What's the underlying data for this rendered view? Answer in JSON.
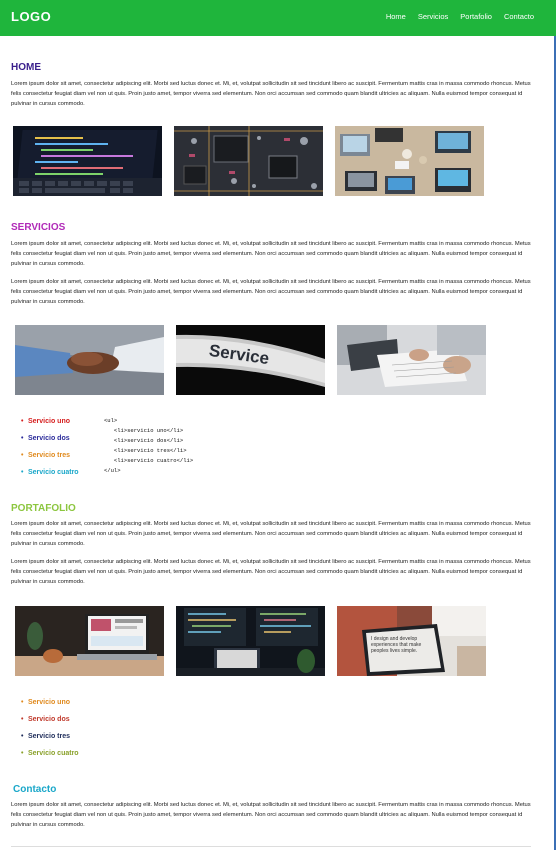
{
  "header": {
    "logo": "LOGO",
    "nav": [
      "Home",
      "Servicios",
      "Portafolio",
      "Contacto"
    ]
  },
  "home": {
    "title": "HOME",
    "text": "Lorem ipsum dolor sit amet, consectetur adipiscing elit. Morbi sed luctus donec et. Mi, et, volutpat sollicitudin sit sed tincidunt libero ac suscipit. Fermentum mattis cras in massa commodo rhoncus. Metus felis consectetur feugiat diam vel non ut quis. Proin justo amet, tempor viverra sed elementum. Non orci accumsan sed commodo quam blandit ultricies ac aliquam. Nulla euismod tempor consequat id pulvinar in cursus commodo."
  },
  "servicios": {
    "title": "SERVICIOS",
    "text1": "Lorem ipsum dolor sit amet, consectetur adipiscing elit. Morbi sed luctus donec et. Mi, et, volutpat sollicitudin sit sed tincidunt libero ac suscipit. Fermentum mattis cras in massa commodo rhoncus. Metus felis consectetur feugiat diam vel non ut quis. Proin justo amet, tempor viverra sed elementum. Non orci accumsan sed commodo quam blandit ultricies ac aliquam. Nulla euismod tempor consequat id pulvinar in cursus commodo.",
    "text2": "Lorem ipsum dolor sit amet, consectetur adipiscing elit. Morbi sed luctus donec et. Mi, et, volutpat sollicitudin sit sed tincidunt libero ac suscipit. Fermentum mattis cras in massa commodo rhoncus. Metus felis consectetur feugiat diam vel non ut quis. Proin justo amet, tempor viverra sed elementum. Non orci accumsan sed commodo quam blandit ultricies ac aliquam. Nulla euismod tempor consequat id pulvinar in cursus commodo.",
    "service_image_label": "Service",
    "items": [
      {
        "label": "Servicio uno",
        "color": "#d62020"
      },
      {
        "label": "Servicio dos",
        "color": "#2a2a9a"
      },
      {
        "label": "Servicio tres",
        "color": "#e08a1e"
      },
      {
        "label": "Servicio cuatro",
        "color": "#1aa7c9"
      }
    ],
    "code": "<ul>\n   <li>servicio uno</li>\n   <li>servicio dos</li>\n   <li>servicio tres</li>\n   <li>servicio cuatro</li>\n</ul>"
  },
  "portafolio": {
    "title": "PORTAFOLIO",
    "text1": "Lorem ipsum dolor sit amet, consectetur adipiscing elit. Morbi sed luctus donec et. Mi, et, volutpat sollicitudin sit sed tincidunt libero ac suscipit. Fermentum mattis cras in massa commodo rhoncus. Metus felis consectetur feugiat diam vel non ut quis. Proin justo amet, tempor viverra sed elementum. Non orci accumsan sed commodo quam blandit ultricies ac aliquam. Nulla euismod tempor consequat id pulvinar in cursus commodo.",
    "text2": "Lorem ipsum dolor sit amet, consectetur adipiscing elit. Morbi sed luctus donec et. Mi, et, volutpat sollicitudin sit sed tincidunt libero ac suscipit. Fermentum mattis cras in massa commodo rhoncus. Metus felis consectetur feugiat diam vel non ut quis. Proin justo amet, tempor viverra sed elementum. Non orci accumsan sed commodo quam blandit ultricies ac aliquam. Nulla euismod tempor consequat id pulvinar in cursus commodo.",
    "screen_text": "I design and develop experiences that make peoples lives simple.",
    "items": [
      {
        "label": "Servicio uno",
        "color": "#e08a1e"
      },
      {
        "label": "Servicio dos",
        "color": "#c0392b"
      },
      {
        "label": "Servicio tres",
        "color": "#1f2d5a"
      },
      {
        "label": "Servicio cuatro",
        "color": "#8aa12a"
      }
    ]
  },
  "contacto": {
    "title": "Contacto",
    "text": "Lorem ipsum dolor sit amet, consectetur adipiscing elit. Morbi sed luctus donec et. Mi, et, volutpat sollicitudin sit sed tincidunt libero ac suscipit. Fermentum mattis cras in massa commodo rhoncus. Metus felis consectetur feugiat diam vel non ut quis. Proin justo amet, tempor viverra sed elementum. Non orci accumsan sed commodo quam blandit ultricies ac aliquam. Nulla euismod tempor consequat id pulvinar in cursus commodo."
  },
  "colors": {
    "header_bg": "#1fb53c",
    "home_title": "#3a1f8c",
    "servicios_title": "#b12ab8",
    "portafolio_title": "#8cc63f",
    "contacto_title": "#1aa7c9"
  }
}
